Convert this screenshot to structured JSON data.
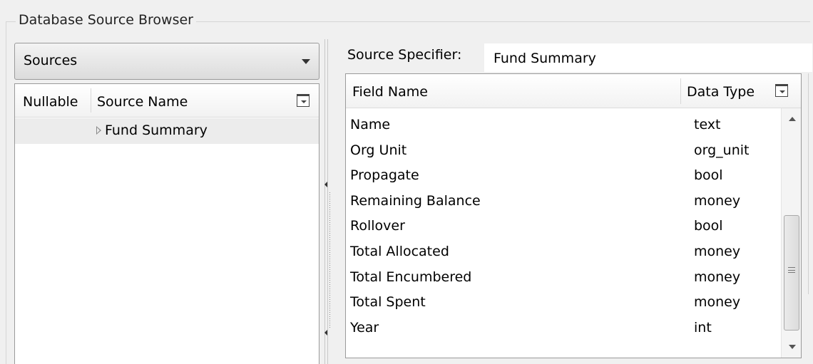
{
  "group": {
    "title": "Database Source Browser"
  },
  "left": {
    "dropdown": {
      "selected": "Sources"
    },
    "columns": {
      "nullable": "Nullable",
      "source_name": "Source Name"
    },
    "rows": [
      {
        "source_name": "Fund Summary",
        "expanded": false
      }
    ]
  },
  "right": {
    "spec_label": "Source Specifier:",
    "spec_value": "Fund Summary",
    "columns": {
      "field_name": "Field Name",
      "data_type": "Data Type"
    },
    "fields": [
      {
        "name": "Name",
        "type": "text"
      },
      {
        "name": "Org Unit",
        "type": "org_unit"
      },
      {
        "name": "Propagate",
        "type": "bool"
      },
      {
        "name": "Remaining Balance",
        "type": "money"
      },
      {
        "name": "Rollover",
        "type": "bool"
      },
      {
        "name": "Total Allocated",
        "type": "money"
      },
      {
        "name": "Total Encumbered",
        "type": "money"
      },
      {
        "name": "Total Spent",
        "type": "money"
      },
      {
        "name": "Year",
        "type": "int"
      }
    ]
  },
  "icons": {
    "dropdown": "chevron-down-icon",
    "expander": "triangle-right-icon",
    "column_menu": "column-chooser-icon",
    "scroll_up": "scroll-up-icon",
    "scroll_down": "scroll-down-icon"
  }
}
